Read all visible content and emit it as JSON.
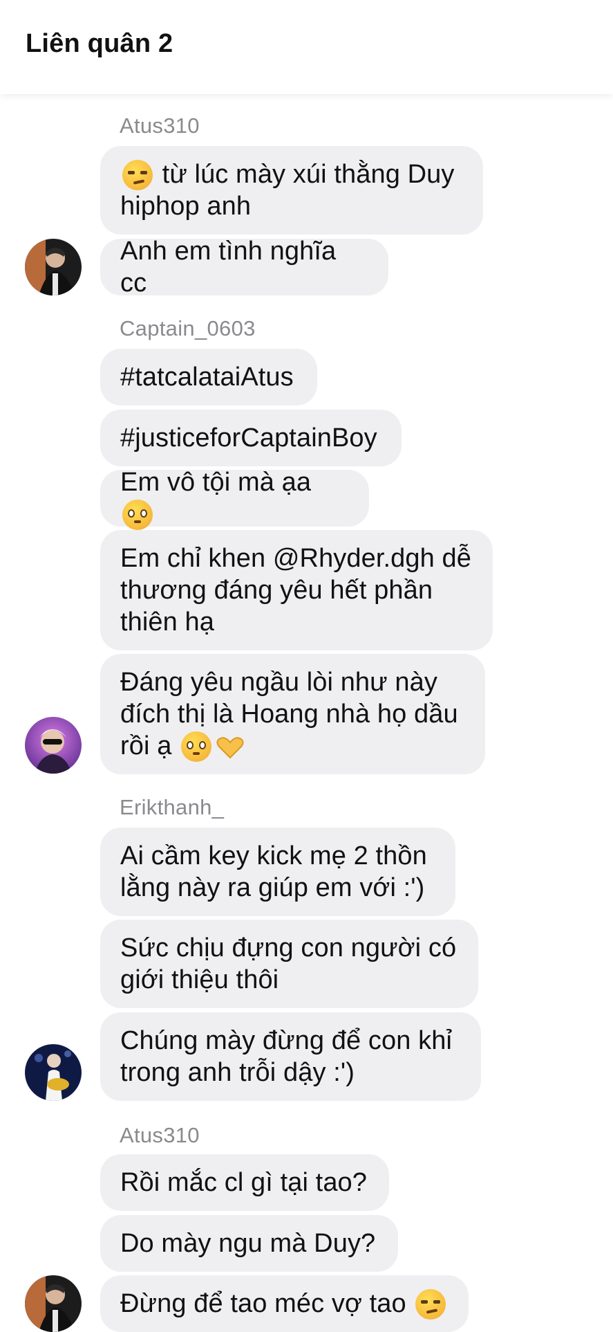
{
  "header": {
    "title": "Liên quân 2"
  },
  "messages": [
    {
      "sender": "Atus310",
      "bubbles": [
        {
          "text": "từ lúc mày xúi thằng Duy\nhiphop anh",
          "emoji_lead": "smirking-face"
        },
        {
          "text": "Anh em tình nghĩa cc"
        }
      ]
    },
    {
      "sender": "Captain_0603",
      "bubbles": [
        {
          "text": "#tatcalataiAtus"
        },
        {
          "text": "#justiceforCaptainBoy"
        },
        {
          "text": "Em vô tội mà ạa",
          "emoji_trail": "pleading-face"
        },
        {
          "text": "Em chỉ khen @Rhyder.dgh dễ\nthương đáng yêu hết phần\nthiên hạ"
        },
        {
          "text": "Đáng yêu ngầu lòi như này\nđích thị là Hoang nhà họ dầu\nrồi ạ",
          "emoji_trail": "pleading-face heart-hands"
        }
      ]
    },
    {
      "sender": "Erikthanh_",
      "bubbles": [
        {
          "text": "Ai cầm key kick mẹ 2 thồn\nlằng này ra giúp em với :')"
        },
        {
          "text": "Sức chịu đựng con người có\ngiới thiệu thôi"
        },
        {
          "text": "Chúng mày đừng để con khỉ\ntrong anh trỗi dậy :')"
        }
      ]
    },
    {
      "sender": "Atus310",
      "bubbles": [
        {
          "text": "Rồi mắc cl gì tại tao?"
        },
        {
          "text": "Do mày ngu mà Duy?"
        },
        {
          "text": "Đừng để tao méc vợ tao",
          "emoji_trail": "smirking-face"
        }
      ]
    }
  ],
  "colors": {
    "bubble": "#efeff2",
    "sender": "#8a8a8e",
    "text": "#111111"
  }
}
